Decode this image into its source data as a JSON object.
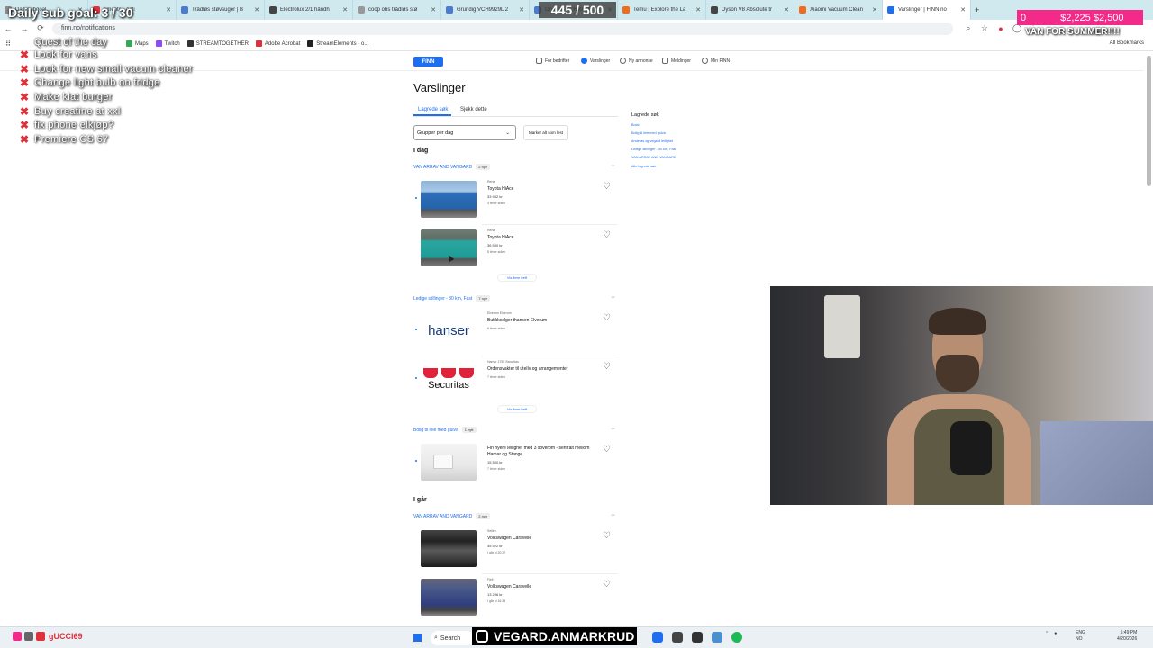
{
  "browser": {
    "tabs": [
      {
        "label": "Dailysubgoal...",
        "color": "#8a8a8a"
      },
      {
        "label": "ements - Acti",
        "color": "#e0303a"
      },
      {
        "label": "Trådløs støvsuger | B",
        "color": "#4a7bd0"
      },
      {
        "label": "Electrolux 2/1 håndh",
        "color": "#444444"
      },
      {
        "label": "coop obs trådløs stø",
        "color": "#999999"
      },
      {
        "label": "Grundig VCH9929L 2",
        "color": "#4a7bd0"
      },
      {
        "label": "Grundig VCH9929L 2",
        "color": "#4a7bd0"
      },
      {
        "label": "Temu | Explore the La",
        "color": "#f26b1d"
      },
      {
        "label": "Dyson V8 Absolute tr",
        "color": "#444444"
      },
      {
        "label": "Xiaomi Vacuum Clean",
        "color": "#f26b1d"
      },
      {
        "label": "Varslinger | FINN.no",
        "color": "#1e6ff0",
        "active": true
      }
    ],
    "url": "finn.no/notifications",
    "bookmarks": [
      {
        "label": "Maps",
        "color": "#34a853"
      },
      {
        "label": "Twitch",
        "color": "#9146ff"
      },
      {
        "label": "STREAMTOGETHER",
        "color": "#333333"
      },
      {
        "label": "Adobe Acrobat",
        "color": "#e0303a"
      },
      {
        "label": "StreamElements - o...",
        "color": "#222222"
      }
    ],
    "all_bookmarks": "All Bookmarks"
  },
  "finn": {
    "logo": "FINN",
    "nav": {
      "new_ad": "For bedrifter",
      "notifications": "Varslinger",
      "ny_annonse": "Ny annonse",
      "messages": "Meldinger",
      "my_finn": "Min FINN"
    },
    "title": "Varslinger",
    "tabs": {
      "saved": "Lagrede søk",
      "check": "Sjekk dette"
    },
    "group_select": "Grupper per dag",
    "mark_all": "Marker alt som lest",
    "today": "I dag",
    "yesterday": "I går",
    "groups": [
      {
        "name": "VAN ARRAV AND VANGARD",
        "count": "2 nye"
      },
      {
        "name": "Ledige stillinger - 30 km, Fast",
        "count": "7 nye"
      },
      {
        "name": "Bolig til leie med gulva",
        "count": "1 nytt"
      },
      {
        "name": "VAN ARRAV AND VANGARD",
        "count": "2 nye"
      }
    ],
    "cards": [
      {
        "loc": "Rena",
        "title": "Toyota HiAce",
        "price": "33 942 kr",
        "ago": "4 timer siden"
      },
      {
        "loc": "Rena",
        "title": "Toyota HiAce",
        "price": "36 500 kr",
        "ago": "5 timer siden"
      },
      {
        "loc": "Elverum Elverum",
        "title": "Butikkselger thansen Elverum",
        "price": "",
        "ago": "6 timer siden"
      },
      {
        "loc": "Hamar 1755 Securitas",
        "title": "Ordensvakter til utelív og arrangementer",
        "price": "",
        "ago": "7 timer siden"
      },
      {
        "loc": "",
        "title": "Fin nyere leilighet med 3 soverom - sentralt mellom Hamar og Stange",
        "price": "15 500 kr",
        "ago": "7 timer siden"
      },
      {
        "loc": "Sellen",
        "title": "Volkswagen Caravelle",
        "price": "35 522 kr",
        "ago": "I går kl 20:27"
      },
      {
        "loc": "Fjell",
        "title": "Volkswagen Caravelle",
        "price": "13 296 kr",
        "ago": "I går kl 16:33"
      }
    ],
    "show_more": "Vis flere treff",
    "logo_hansen": "hanser",
    "logo_securitas": "Securitas",
    "saved_panel": {
      "title": "Lagrede søk",
      "links": [
        "Bolal",
        "Bolig til leie med gulva",
        "Anderas og vegard leilighet",
        "Ledige stillinger - 30 km, Fast",
        "VAN ARRAV AND VANGARD"
      ],
      "all": "Alle lagrede søk"
    }
  },
  "overlays": {
    "goal": "Daily sub goal: 3 / 30",
    "counter": "445 / 500",
    "money_left": "0",
    "money": "$2,225  $2,500",
    "van": "VAN FOR SUMMER!!!!",
    "quest_title": "Quest of the day",
    "quests": [
      "Look for vans",
      "Look for new small vacum cleaner",
      "Change light bulb on fridge",
      "Make klat burger",
      "Buy creatine at xxl",
      "fix phone elkjøp?",
      "Premiere CS 67"
    ]
  },
  "taskbar": {
    "gucci": "gUCCI69",
    "gucci2": "",
    "search": "Search",
    "banner": "VEGARD.ANMARKRUD",
    "lang1": "ENG",
    "lang2": "NO",
    "time": "5:49 PM",
    "date": "4/20/2026"
  }
}
